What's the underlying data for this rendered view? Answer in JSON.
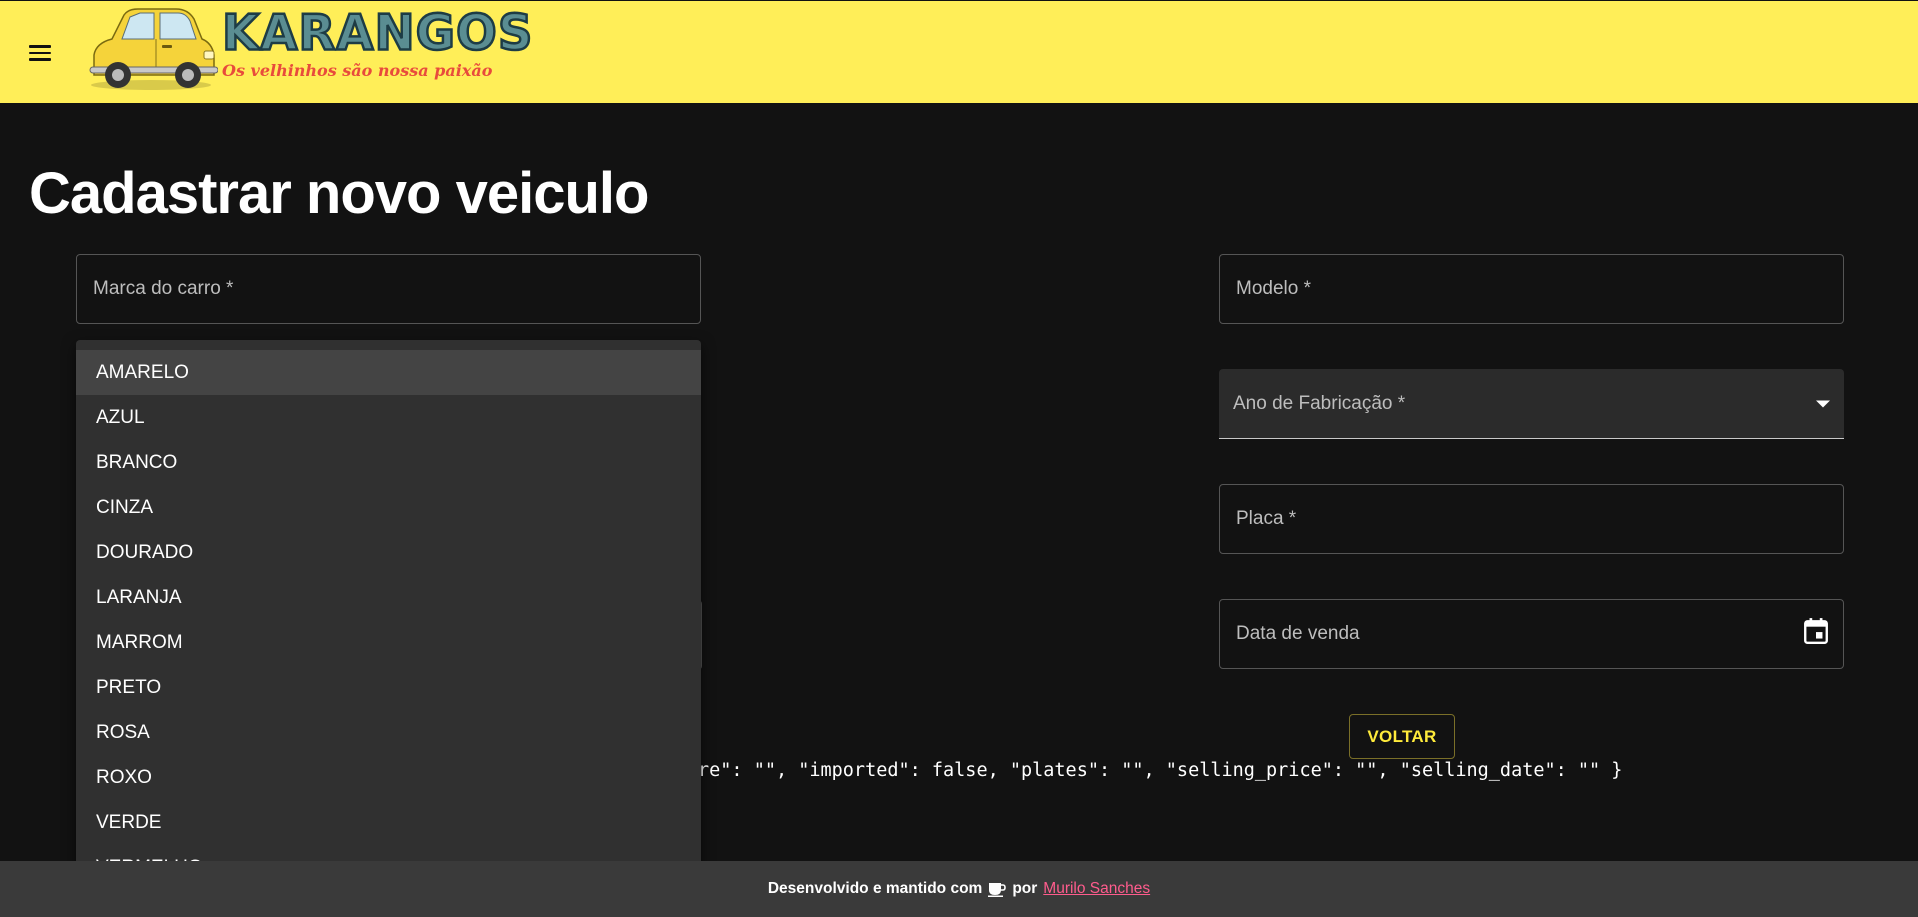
{
  "header": {
    "menu_icon": "hamburger-menu-icon",
    "logo": {
      "title": "KARANGOS",
      "tagline": "Os velhinhos são nossa paixão",
      "car_color": "#f5d33a"
    },
    "background": "#ffee58"
  },
  "page": {
    "title": "Cadastrar novo veiculo"
  },
  "form": {
    "brand_label": "Marca do carro *",
    "model_label": "Modelo *",
    "year_label": "Ano de Fabricação *",
    "plates_label": "Placa *",
    "selling_date_label": "Data de venda",
    "calendar_icon": "calendar-icon",
    "dropdown_icon": "caret-down-icon",
    "back_button": "VOLTAR",
    "json_preview": "re\": \"\", \"imported\": false, \"plates\": \"\", \"selling_price\": \"\", \"selling_date\": \"\" }"
  },
  "color_dropdown": {
    "options": [
      "AMARELO",
      "AZUL",
      "BRANCO",
      "CINZA",
      "DOURADO",
      "LARANJA",
      "MARROM",
      "PRETO",
      "ROSA",
      "ROXO",
      "VERDE",
      "VERMELHO"
    ],
    "highlighted": "AMARELO"
  },
  "footer": {
    "text_before": "Desenvolvido e mantido com",
    "text_by": "por",
    "author": "Murilo Sanches",
    "icon": "coffee-cup-icon"
  },
  "colors": {
    "accent": "#ffeb3b",
    "link": "#ff5c8d",
    "background": "#121212"
  }
}
